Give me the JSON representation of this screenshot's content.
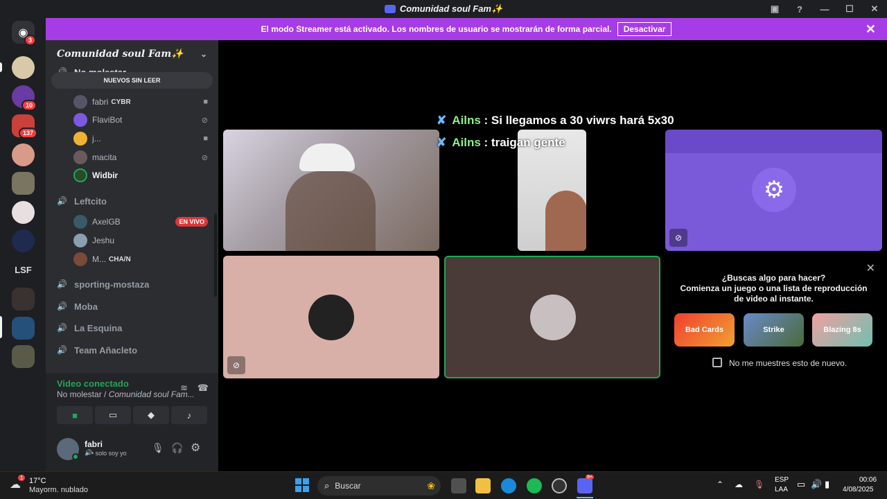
{
  "window": {
    "title": "Comunidad soul Fam✨"
  },
  "guilds": {
    "home_badge": "3",
    "badge_10": "10",
    "badge_137": "137",
    "lsf_label": "LSF"
  },
  "banner": {
    "text": "El modo Streamer está activado. Los nombres de usuario se mostrarán de forma parcial.",
    "button": "Desactivar"
  },
  "server": {
    "name": "Comunidad soul Fam✨"
  },
  "unread_label": "NUEVOS SIN LEER",
  "channels": [
    {
      "name": "No molestar"
    },
    {
      "name": "Leftcito"
    },
    {
      "name": "sporting-mostaza"
    },
    {
      "name": "Moba"
    },
    {
      "name": "La Esquina"
    },
    {
      "name": "Team Añacleto"
    }
  ],
  "users_no_molestar": [
    {
      "name": "fabri",
      "tag": "CYBR"
    },
    {
      "name": "FlaviBot"
    },
    {
      "name": "j..."
    },
    {
      "name": "macita"
    },
    {
      "name": "Widbir"
    }
  ],
  "users_leftcito": [
    {
      "name": "AxelGB",
      "badge": "EN VIVO"
    },
    {
      "name": "Jeshu"
    },
    {
      "name": "M...",
      "tag": "CHA/N"
    }
  ],
  "voice": {
    "status": "Video conectado",
    "location_prefix": "No molestar /",
    "location_server": "Comunidad soul Fam..."
  },
  "user_panel": {
    "name": "fabri",
    "status": "• solo soy yo"
  },
  "stream_overlay": [
    {
      "name": "Ailns",
      "text": ": Si llegamos a 30 viwrs hará 5x30"
    },
    {
      "name": "Ailns",
      "text": ": traigan gente"
    }
  ],
  "activity_panel": {
    "title": "¿Buscas algo para hacer?",
    "subtitle": "Comienza un juego o una lista de reproducción de video al instante.",
    "checkbox_label": "No me muestres esto de nuevo.",
    "games": [
      {
        "name": "Bad Cards"
      },
      {
        "name": "Strike"
      },
      {
        "name": "Blazing 8s"
      }
    ]
  },
  "taskbar": {
    "weather_temp": "17°C",
    "weather_desc": "Mayorm. nublado",
    "weather_badge": "1",
    "search_placeholder": "Buscar",
    "lang_top": "ESP",
    "lang_bottom": "LAA",
    "time": "00:06",
    "date": "4/08/2025",
    "discord_badge": "9+"
  },
  "colors": {
    "accent": "#5865f2",
    "streamer_banner": "#a63ce6",
    "connected_green": "#23a559",
    "live_red": "#da373c"
  }
}
